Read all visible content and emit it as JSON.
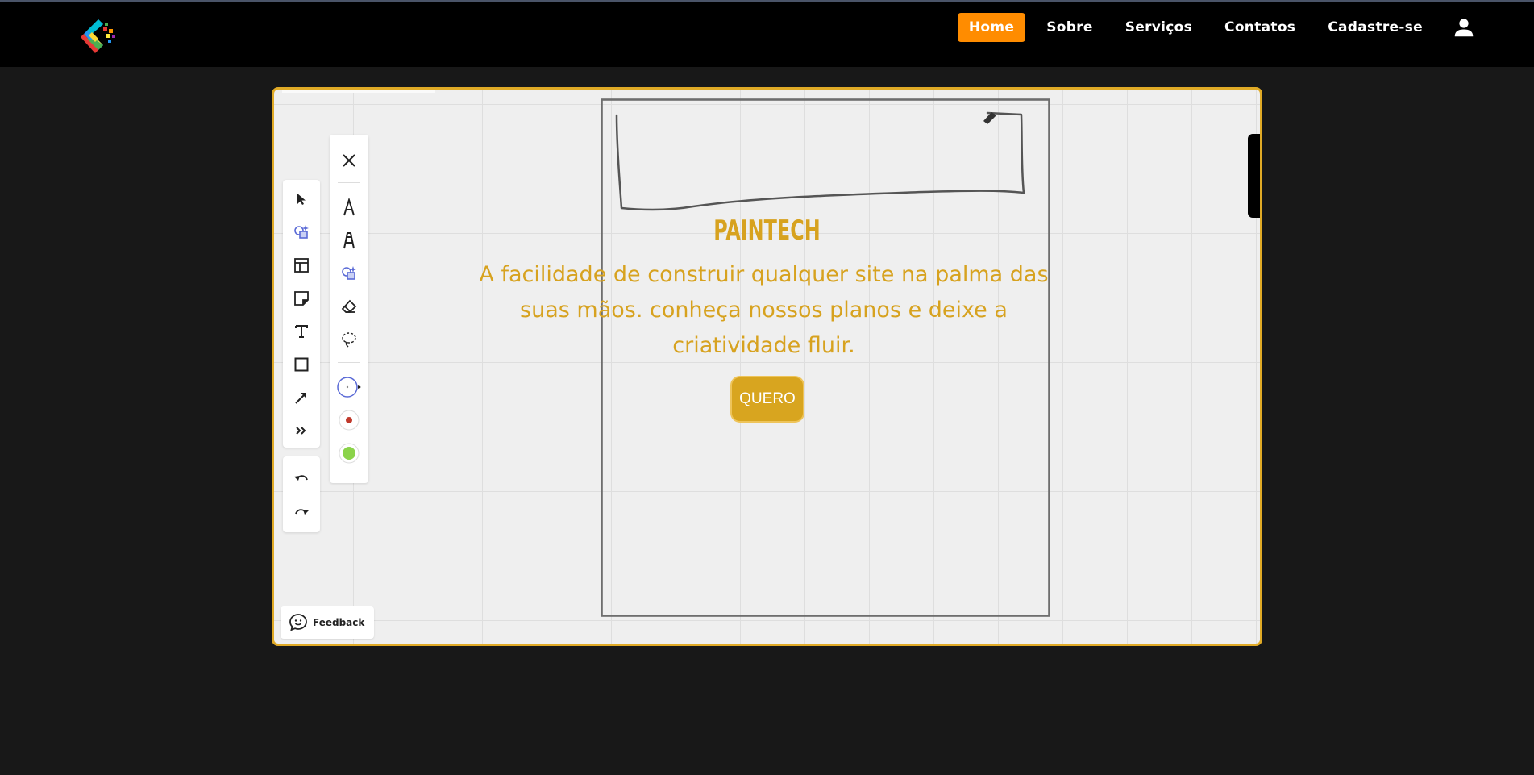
{
  "nav": {
    "items": [
      {
        "label": "Home",
        "active": true
      },
      {
        "label": "Sobre",
        "active": false
      },
      {
        "label": "Serviços",
        "active": false
      },
      {
        "label": "Contatos",
        "active": false
      },
      {
        "label": "Cadastre-se",
        "active": false
      }
    ],
    "user_icon": "user-icon",
    "accent_color": "#ff8c00"
  },
  "hero": {
    "brand": "PAINTECH",
    "tagline": "A facilidade de construir qualquer site na palma das suas mãos. conheça nossos planos e deixe a criatividade fluir.",
    "cta_label": "QUERO",
    "accent_color": "#d7a21f"
  },
  "whiteboard": {
    "feedback_label": "Feedback",
    "toolbar_tools": [
      "select-icon",
      "shapes-icon",
      "layout-icon",
      "sticky-note-icon",
      "text-icon",
      "rectangle-icon",
      "arrow-icon",
      "more-icon"
    ],
    "history_tools": [
      "undo-icon",
      "redo-icon"
    ],
    "pen_tools": [
      "close-icon",
      "pen-icon",
      "marker-icon",
      "shapes-icon",
      "eraser-icon",
      "lasso-icon",
      "size-small-icon",
      "color-red-icon",
      "color-green-icon"
    ]
  }
}
